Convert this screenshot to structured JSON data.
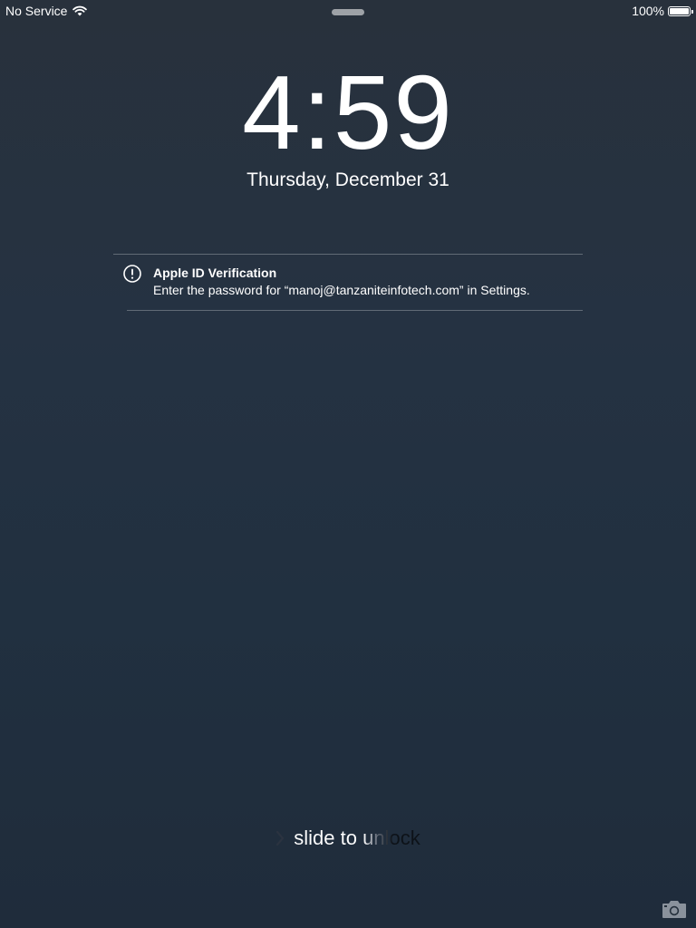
{
  "status_bar": {
    "carrier": "No Service",
    "battery_percent_text": "100%",
    "battery_level": 1.0,
    "wifi_icon": "wifi-icon"
  },
  "lock_screen": {
    "time_hour": "4",
    "time_minutes": "59",
    "date": "Thursday, December 31"
  },
  "notification": {
    "icon": "alert-icon",
    "title": "Apple ID Verification",
    "body": "Enter the password for “manoj@tanzaniteinfotech.com” in Settings."
  },
  "unlock": {
    "label": "slide to unlock",
    "icon": "chevron-right-icon"
  },
  "camera": {
    "icon": "camera-icon"
  }
}
